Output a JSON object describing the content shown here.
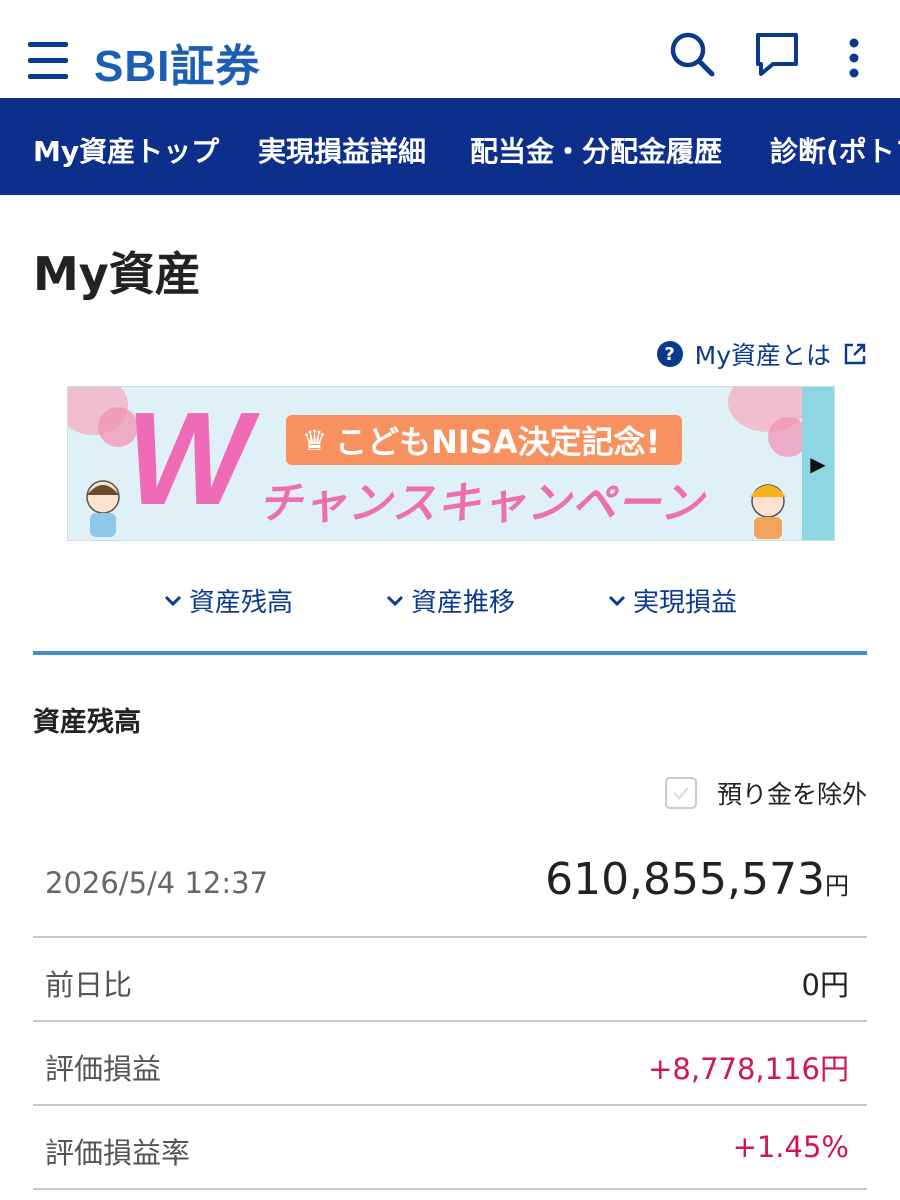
{
  "header": {
    "logo_text": "SBI証券",
    "logo_color": "#1a5fb4",
    "icons": [
      "menu-icon",
      "search-icon",
      "chat-icon",
      "more-vertical-icon"
    ]
  },
  "nav": {
    "background": "#0d2e8a",
    "items": [
      {
        "label": "My資産トップ"
      },
      {
        "label": "実現損益詳細"
      },
      {
        "label": "配当金・分配金履歴"
      },
      {
        "label": "診断(ポトフ"
      }
    ]
  },
  "page": {
    "title": "My資産",
    "help_label": "My資産とは"
  },
  "banner": {
    "w": "W",
    "headline": "こどもNISA決定記念!",
    "sub": "チャンスキャンペーン"
  },
  "section_tabs": [
    {
      "label": "資産残高"
    },
    {
      "label": "資産推移"
    },
    {
      "label": "実現損益"
    }
  ],
  "balance": {
    "title": "資産残高",
    "exclude_label": "預り金を除外",
    "exclude_checked": false,
    "timestamp": "2026/5/4 12:37",
    "total": "610,855,573",
    "unit": "円",
    "rows": [
      {
        "label": "前日比",
        "value": "0円",
        "positive": false
      },
      {
        "label": "評価損益",
        "value": "+8,778,116円",
        "positive": true
      },
      {
        "label": "評価損益率",
        "value": "+1.45%",
        "positive": true
      }
    ],
    "positive_color": "#d0155a"
  }
}
